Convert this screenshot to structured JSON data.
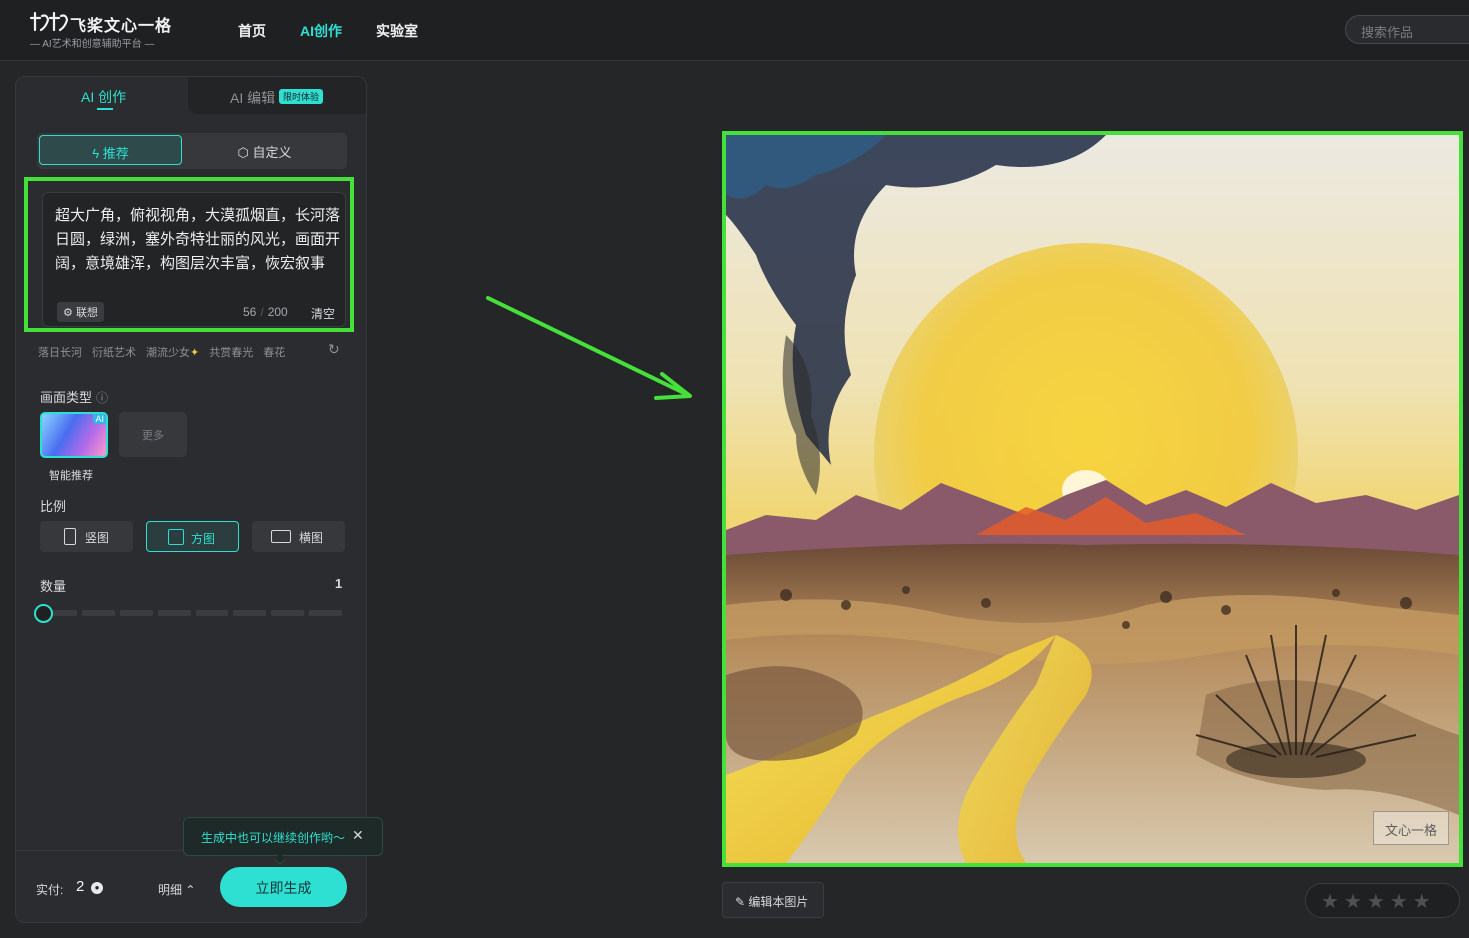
{
  "brand": {
    "name": "飞桨文心一格",
    "tagline": "— AI艺术和创意辅助平台 —"
  },
  "nav": {
    "items": [
      "首页",
      "AI创作",
      "实验室"
    ],
    "active": "AI创作"
  },
  "search": {
    "placeholder": "搜索作品"
  },
  "panel": {
    "tabs": {
      "create": "AI 创作",
      "edit": "AI 编辑",
      "edit_badge": "限时体验"
    },
    "modes": {
      "recommend": "推荐",
      "custom": "自定义",
      "active": "推荐"
    },
    "prompt": {
      "text": "超大广角，俯视视角，大漠孤烟直，长河落日圆，绿洲，塞外奇特壮丽的风光，画面开阔，意境雄浑，构图层次丰富，恢宏叙事",
      "assoc_label": "联想",
      "count": "56",
      "max": "200",
      "clear_label": "清空"
    },
    "suggestions": [
      "落日长河",
      "衍纸艺术",
      "潮流少女",
      "共赏春光",
      "春花"
    ],
    "picture_type": {
      "label": "画面类型",
      "selected": "智能推荐",
      "more": "更多",
      "ai_tag": "AI"
    },
    "ratio": {
      "label": "比例",
      "options": [
        "竖图",
        "方图",
        "横图"
      ],
      "selected": "方图"
    },
    "quantity": {
      "label": "数量",
      "value": "1",
      "fraction": 0.0
    },
    "footer": {
      "pay_label": "实付:",
      "pay_value": "2",
      "detail_label": "明细",
      "generate_label": "立即生成"
    },
    "tooltip": {
      "text": "生成中也可以继续创作哟～"
    }
  },
  "result": {
    "watermark": "文心一格",
    "edit_label": "编辑本图片",
    "rating": {
      "max": 5,
      "value": 0
    }
  },
  "colors": {
    "accent": "#2ee0d1",
    "highlight": "#46e03b",
    "background": "#252628"
  },
  "icons": [
    "lightning-icon",
    "cube-icon",
    "sparkle-icon",
    "refresh-icon",
    "info-icon",
    "coin-icon",
    "chevron-up-icon",
    "close-icon",
    "edit-icon",
    "star-icon"
  ]
}
